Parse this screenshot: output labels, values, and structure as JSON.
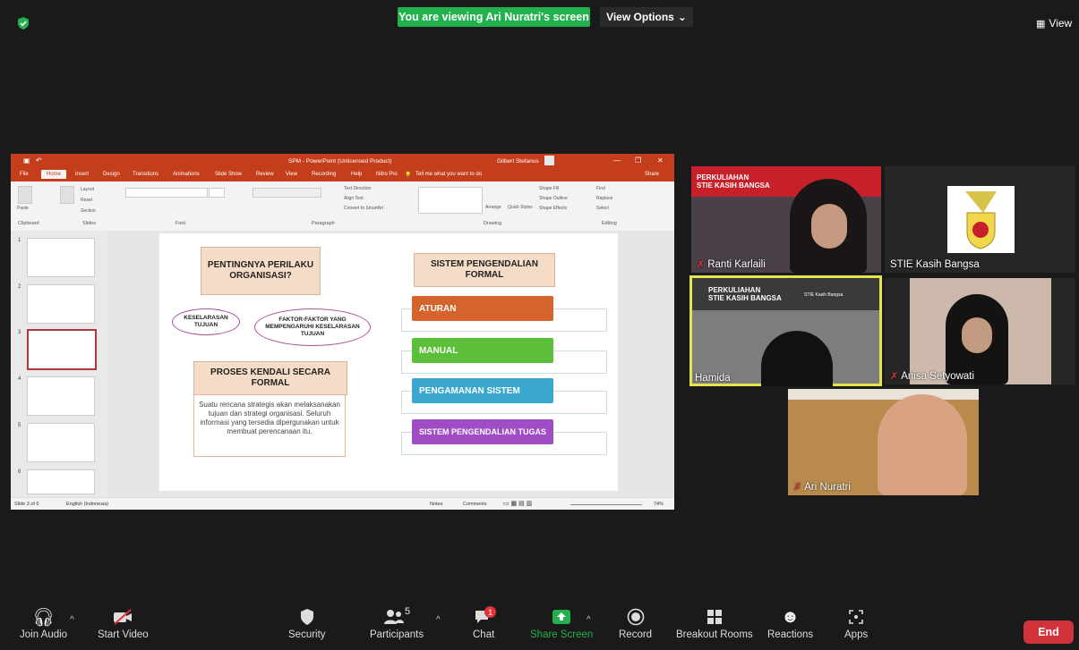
{
  "top": {
    "banner": "You are viewing Ari Nuratri's screen",
    "view_options": "View Options",
    "view": "View"
  },
  "ppt": {
    "title": "SPM - PowerPoint (Unlicensed Product)",
    "user": "Gilbert Stefanus",
    "tabs": [
      "File",
      "Home",
      "Insert",
      "Design",
      "Transitions",
      "Animations",
      "Slide Show",
      "Review",
      "View",
      "Recording",
      "Help",
      "Nitro Pro"
    ],
    "tell_me": "Tell me what you want to do",
    "share": "Share",
    "ribbon_groups": [
      "Clipboard",
      "Slides",
      "Font",
      "Paragraph",
      "Drawing",
      "Editing"
    ],
    "ribbon_items": {
      "paste": "Paste",
      "layout": "Layout",
      "reset": "Reset",
      "new_slide": "New Slide",
      "section": "Section",
      "text_direction": "Text Direction",
      "align_text": "Align Text",
      "smartart": "Convert to SmartArt",
      "arrange": "Arrange",
      "quick_styles": "Quick Styles",
      "shape_fill": "Shape Fill",
      "shape_outline": "Shape Outline",
      "shape_effects": "Shape Effects",
      "find": "Find",
      "replace": "Replace",
      "select": "Select"
    },
    "thumb_numbers": [
      "1",
      "2",
      "3",
      "4",
      "5",
      "6"
    ],
    "status": {
      "slide": "Slide 3 of 6",
      "language": "English (Indonesia)",
      "notes": "Notes",
      "comments": "Comments",
      "zoom": "74%"
    }
  },
  "slide": {
    "heading_left": "PENTINGNYA PERILAKU ORGANISASI?",
    "oval1": "KESELARASAN TUJUAN",
    "oval2": "FAKTOR-FAKTOR YANG MEMPENGARUHI KESELARASAN TUJUAN",
    "heading_proses": "PROSES KENDALI SECARA FORMAL",
    "body": "Suatu rencana strategis akan melaksanakan tujuan dan strategi organisasi. Seluruh informasi yang tersedia dipergunakan untuk membuat perencanaan itu.",
    "heading_right": "SISTEM PENGENDALIAN FORMAL",
    "bars": [
      "ATURAN",
      "MANUAL",
      "PENGAMANAN SISTEM",
      "SISTEM PENGENDALIAN TUGAS"
    ],
    "bar_colors": [
      "#d4642c",
      "#5cbf3a",
      "#3ba7cf",
      "#a04cc4"
    ]
  },
  "participants": {
    "ranti": {
      "name": "Ranti Karlaili",
      "banner1": "PERKULIAHAN",
      "banner2": "STIE KASIH BANGSA"
    },
    "stie": {
      "name": "STIE Kasih Bangsa"
    },
    "hamida": {
      "name": "Hamida",
      "banner1": "PERKULIAHAN",
      "banner2": "STIE KASIH BANGSA",
      "banner3": "STIE Kasih Bangsa"
    },
    "anisa": {
      "name": "Anisa Setyowati"
    },
    "ari": {
      "name": "Ari Nuratri"
    }
  },
  "toolbar": {
    "join_audio": "Join Audio",
    "start_video": "Start Video",
    "security": "Security",
    "participants": "Participants",
    "participants_count": "5",
    "chat": "Chat",
    "chat_badge": "1",
    "share_screen": "Share Screen",
    "record": "Record",
    "breakout": "Breakout Rooms",
    "reactions": "Reactions",
    "apps": "Apps",
    "end": "End"
  }
}
